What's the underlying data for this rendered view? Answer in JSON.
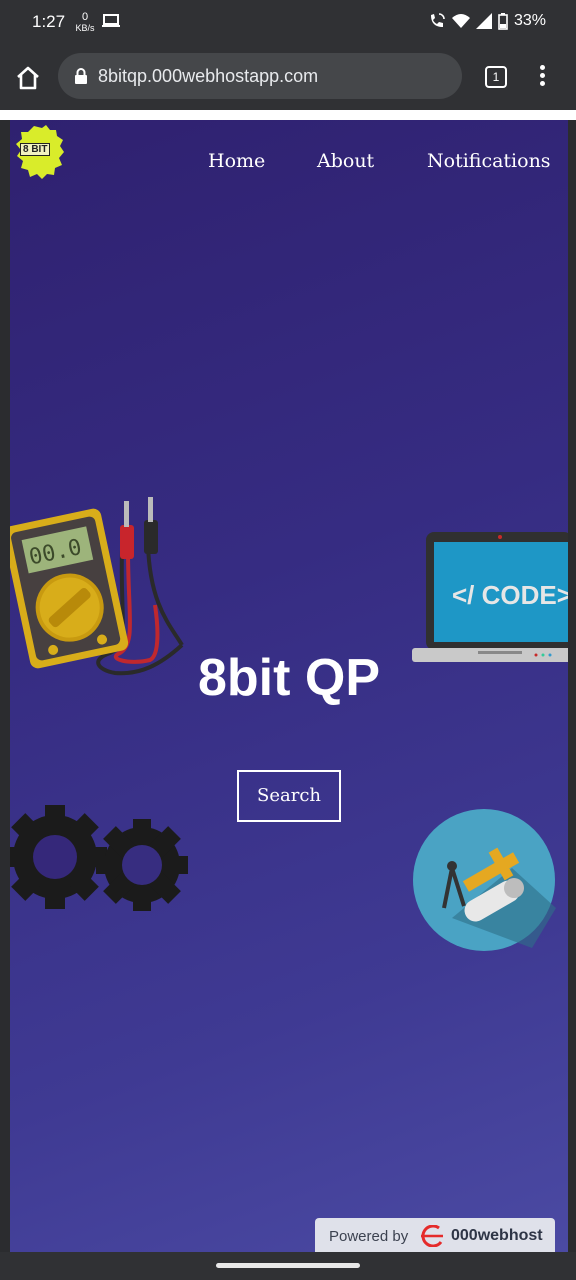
{
  "status_bar": {
    "time": "1:27",
    "net_speed_value": "0",
    "net_speed_unit": "KB/s",
    "battery": "33%"
  },
  "browser": {
    "url": "8bitqp.000webhostapp.com",
    "tab_count": "1"
  },
  "site": {
    "logo_text": "8 BIT",
    "nav": [
      "Home",
      "About",
      "Notifications"
    ],
    "hero_title": "8bit QP",
    "search_label": "Search",
    "laptop_screen_text": "</ CODE>"
  },
  "footer_badge": {
    "label": "Powered by",
    "brand": "000webhost"
  },
  "colors": {
    "gradient_start": "#2f2170",
    "gradient_end": "#4b4aa3",
    "logo_yellow": "#d9ec2a",
    "browser_bar": "#303134"
  }
}
